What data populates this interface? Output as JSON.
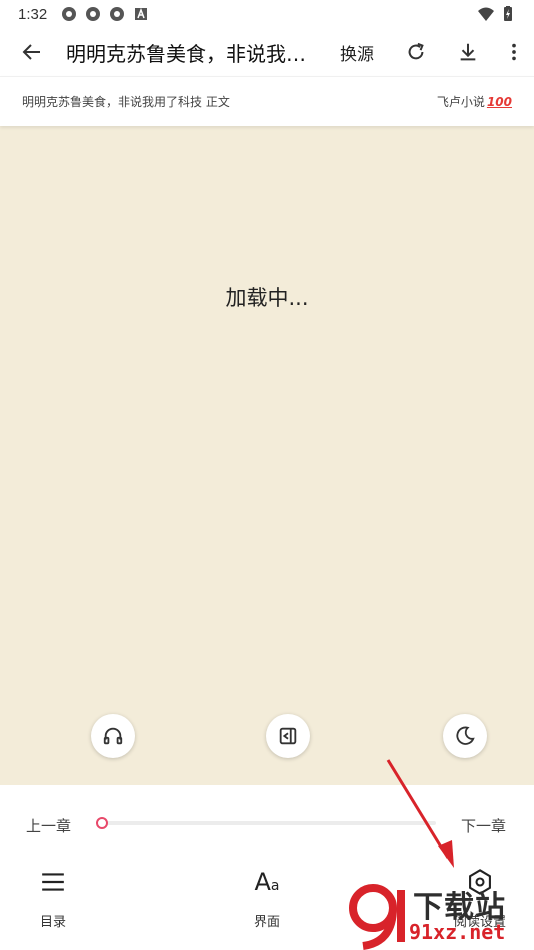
{
  "status_bar": {
    "time": "1:32",
    "left_icons": [
      "aperture-icon",
      "aperture-icon",
      "aperture-icon",
      "a-box-icon"
    ],
    "right_icons": [
      "wifi-icon",
      "battery-icon"
    ]
  },
  "app_bar": {
    "title": "明明克苏鲁美食，非说我用了科技",
    "change_source_label": "换源"
  },
  "sub_header": {
    "chapter_info": "明明克苏鲁美食，非说我用了科技 正文",
    "source_name": "飞卢小说",
    "source_emoji": "100"
  },
  "reader": {
    "loading_text": "加载中..."
  },
  "fabs": {
    "listen_icon": "headphones-icon",
    "auto_page_icon": "auto-page-icon",
    "night_icon": "moon-icon"
  },
  "bottom_panel": {
    "prev_chapter": "上一章",
    "next_chapter": "下一章",
    "progress": 0,
    "nav": {
      "toc_label": "目录",
      "ui_label": "界面",
      "settings_label": "阅读设置"
    }
  },
  "watermark": {
    "top": "下载站",
    "bottom": "91xz.net"
  },
  "colors": {
    "reader_bg": "#f3ecd9",
    "accent": "#e8496a",
    "arrow": "#d8232a"
  }
}
